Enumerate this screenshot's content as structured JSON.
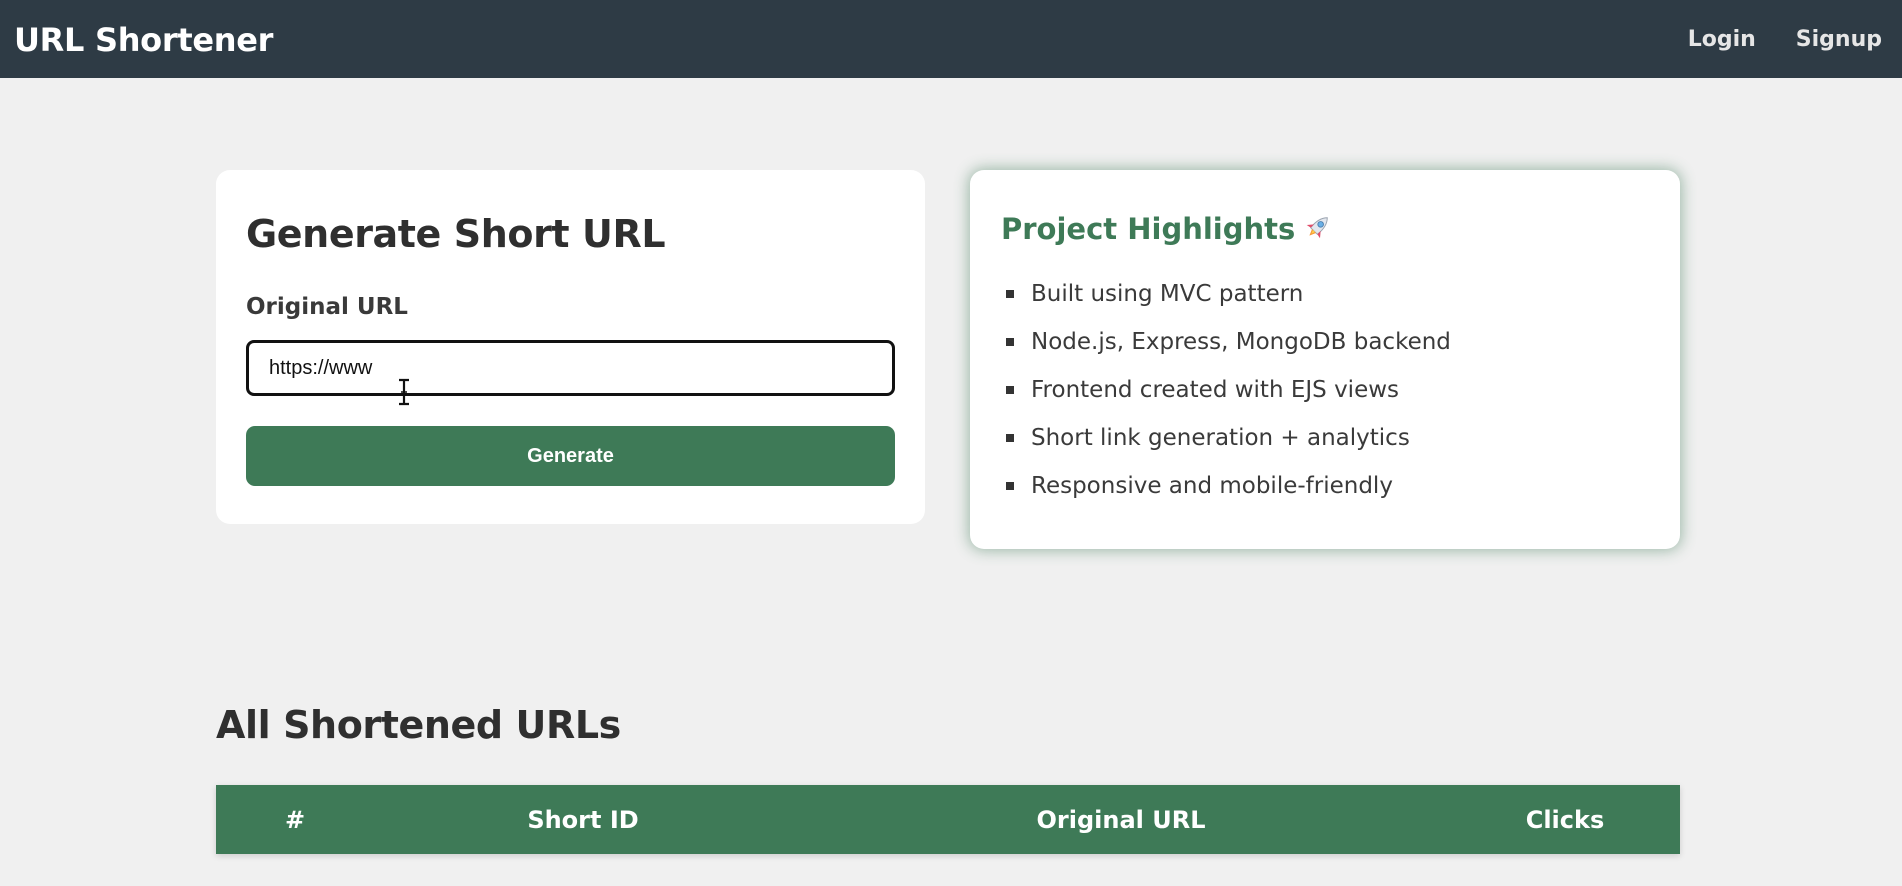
{
  "navbar": {
    "brand": "URL Shortener",
    "links": [
      "Login",
      "Signup"
    ]
  },
  "form_card": {
    "title": "Generate Short URL",
    "field_label": "Original URL",
    "input_value": "https://www",
    "button_label": "Generate"
  },
  "highlights_card": {
    "title": "Project Highlights",
    "title_icon": "rocket-icon",
    "items": [
      "Built using MVC pattern",
      "Node.js, Express, MongoDB backend",
      "Frontend created with EJS views",
      "Short link generation + analytics",
      "Responsive and mobile-friendly"
    ]
  },
  "urls_section": {
    "title": "All Shortened URLs",
    "columns": [
      "#",
      "Short ID",
      "Original URL",
      "Clicks"
    ]
  },
  "colors": {
    "navbar_bg": "#2e3b45",
    "accent_green": "#3e7a57",
    "page_bg": "#f0f0f0"
  }
}
